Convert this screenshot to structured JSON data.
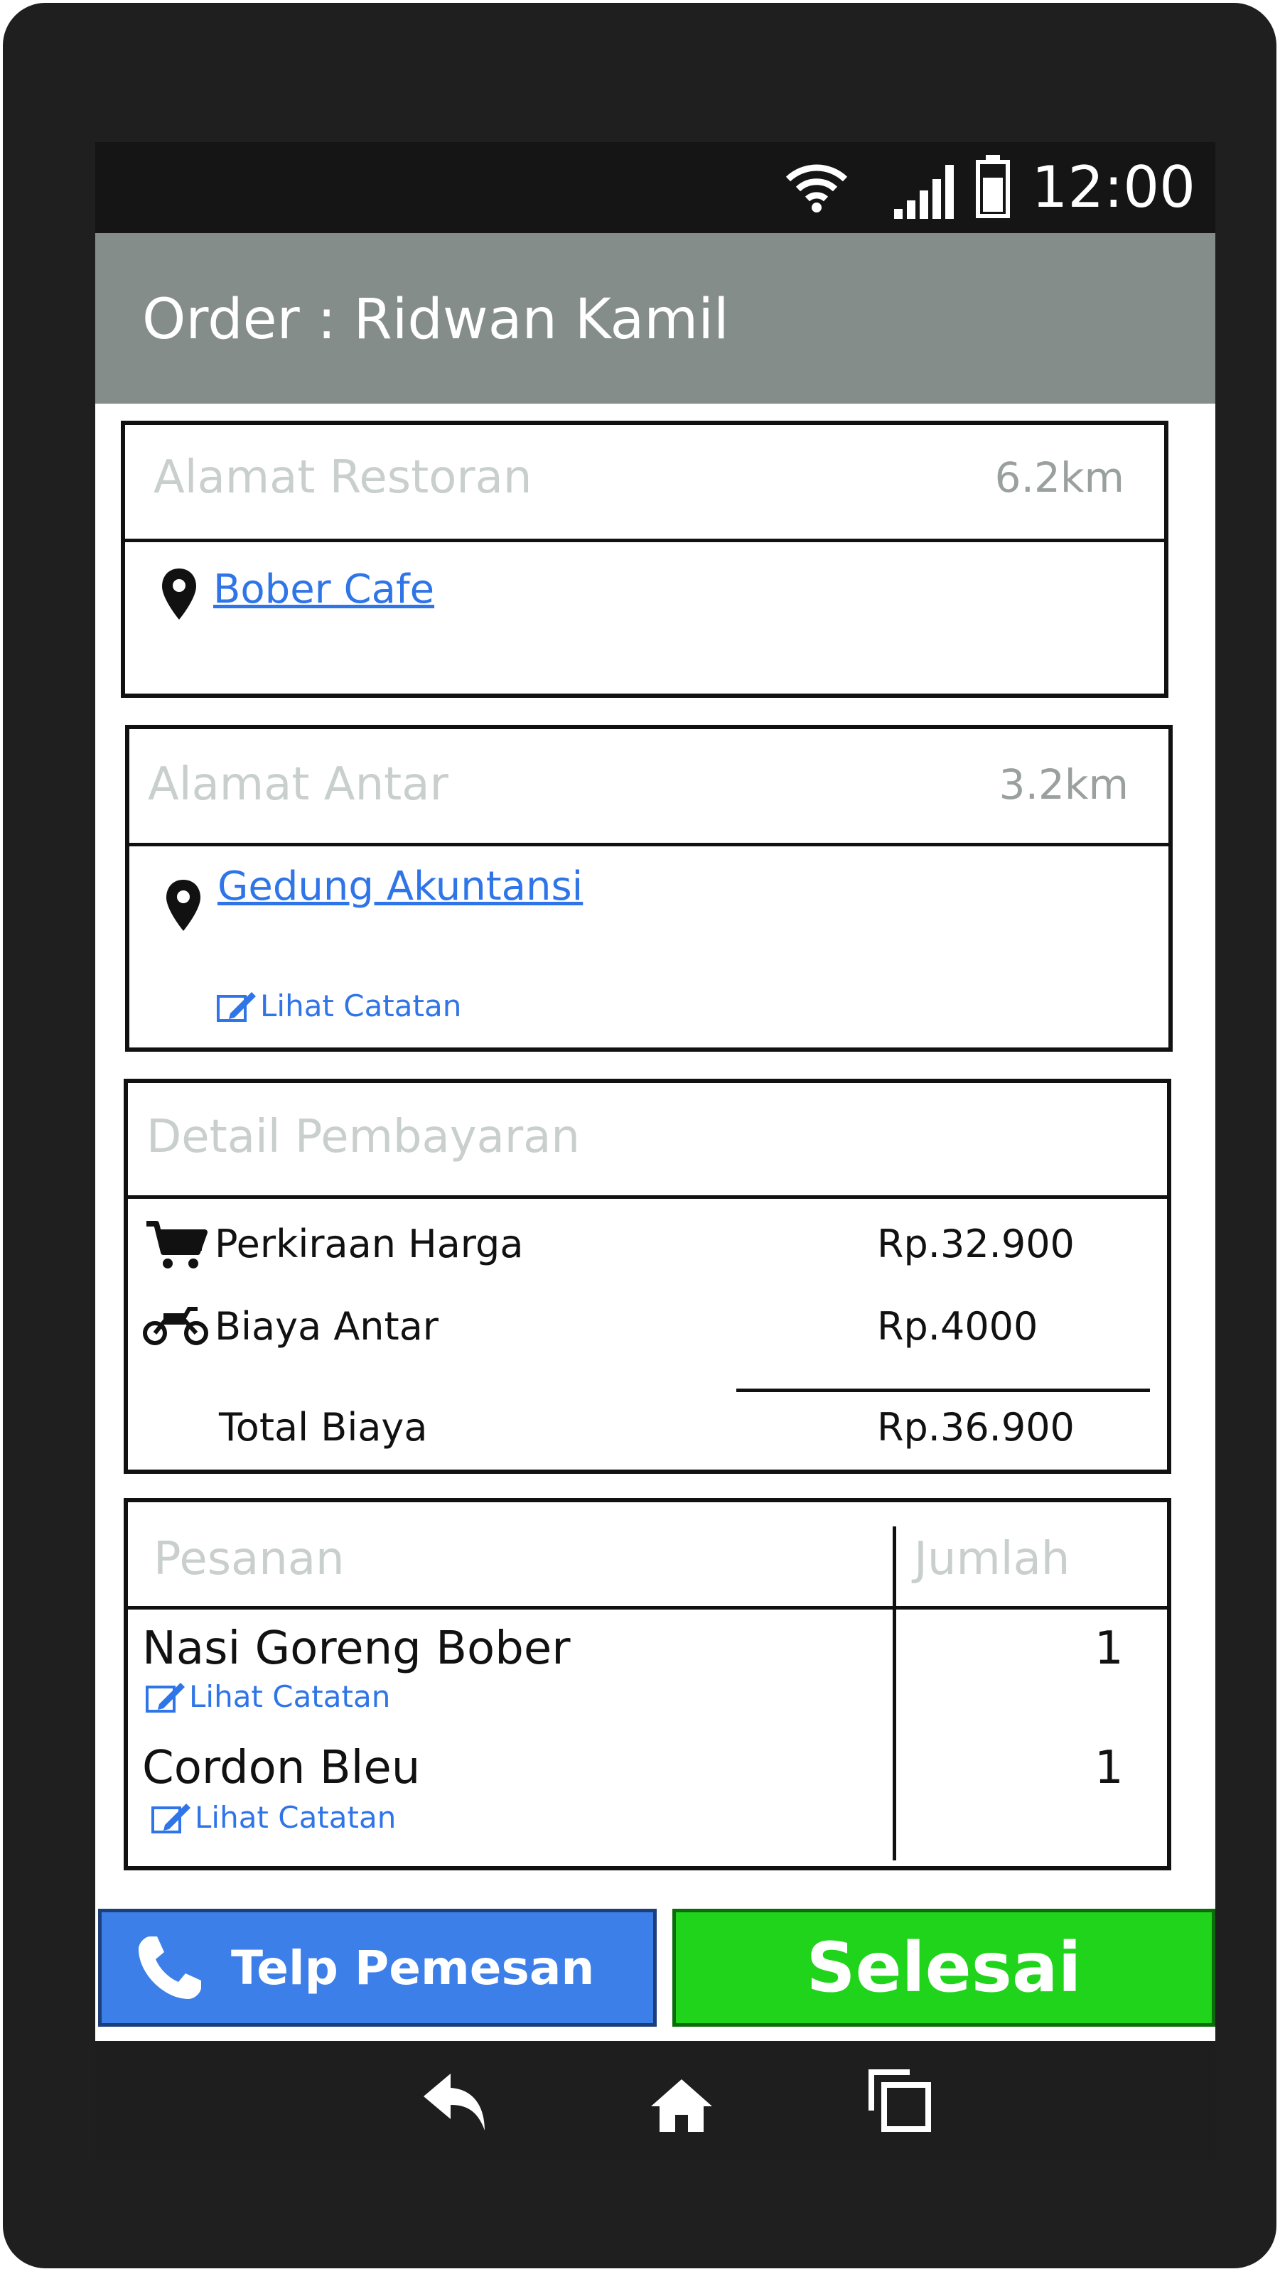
{
  "status_bar": {
    "time": "12:00",
    "icons": [
      "wifi-icon",
      "signal-icon",
      "battery-icon"
    ]
  },
  "header": {
    "title": "Order : Ridwan Kamil"
  },
  "restaurant": {
    "label": "Alamat Restoran",
    "distance": "6.2km",
    "name": "Bober Cafe"
  },
  "delivery": {
    "label": "Alamat Antar",
    "distance": "3.2km",
    "address": "Gedung Akuntansi",
    "note_link": "Lihat Catatan"
  },
  "payment": {
    "label": "Detail Pembayaran",
    "estimated_price_label": "Perkiraan Harga",
    "estimated_price": "Rp.32.900",
    "delivery_fee_label": "Biaya Antar",
    "delivery_fee": "Rp.4000",
    "total_label": "Total Biaya",
    "total": "Rp.36.900"
  },
  "orders": {
    "label": "Pesanan",
    "qty_label": "Jumlah",
    "items": [
      {
        "name": "Nasi Goreng Bober",
        "qty": "1",
        "note_link": "Lihat Catatan"
      },
      {
        "name": "Cordon Bleu",
        "qty": "1",
        "note_link": "Lihat Catatan"
      }
    ]
  },
  "actions": {
    "call_label": "Telp Pemesan",
    "done_label": "Selesai"
  },
  "nav": {
    "icons": [
      "back-icon",
      "home-icon",
      "recent-apps-icon"
    ]
  },
  "colors": {
    "header": "#858d8a",
    "link": "#2f75e8",
    "call_button": "#3d7fe9",
    "done_button": "#1fd41a"
  }
}
